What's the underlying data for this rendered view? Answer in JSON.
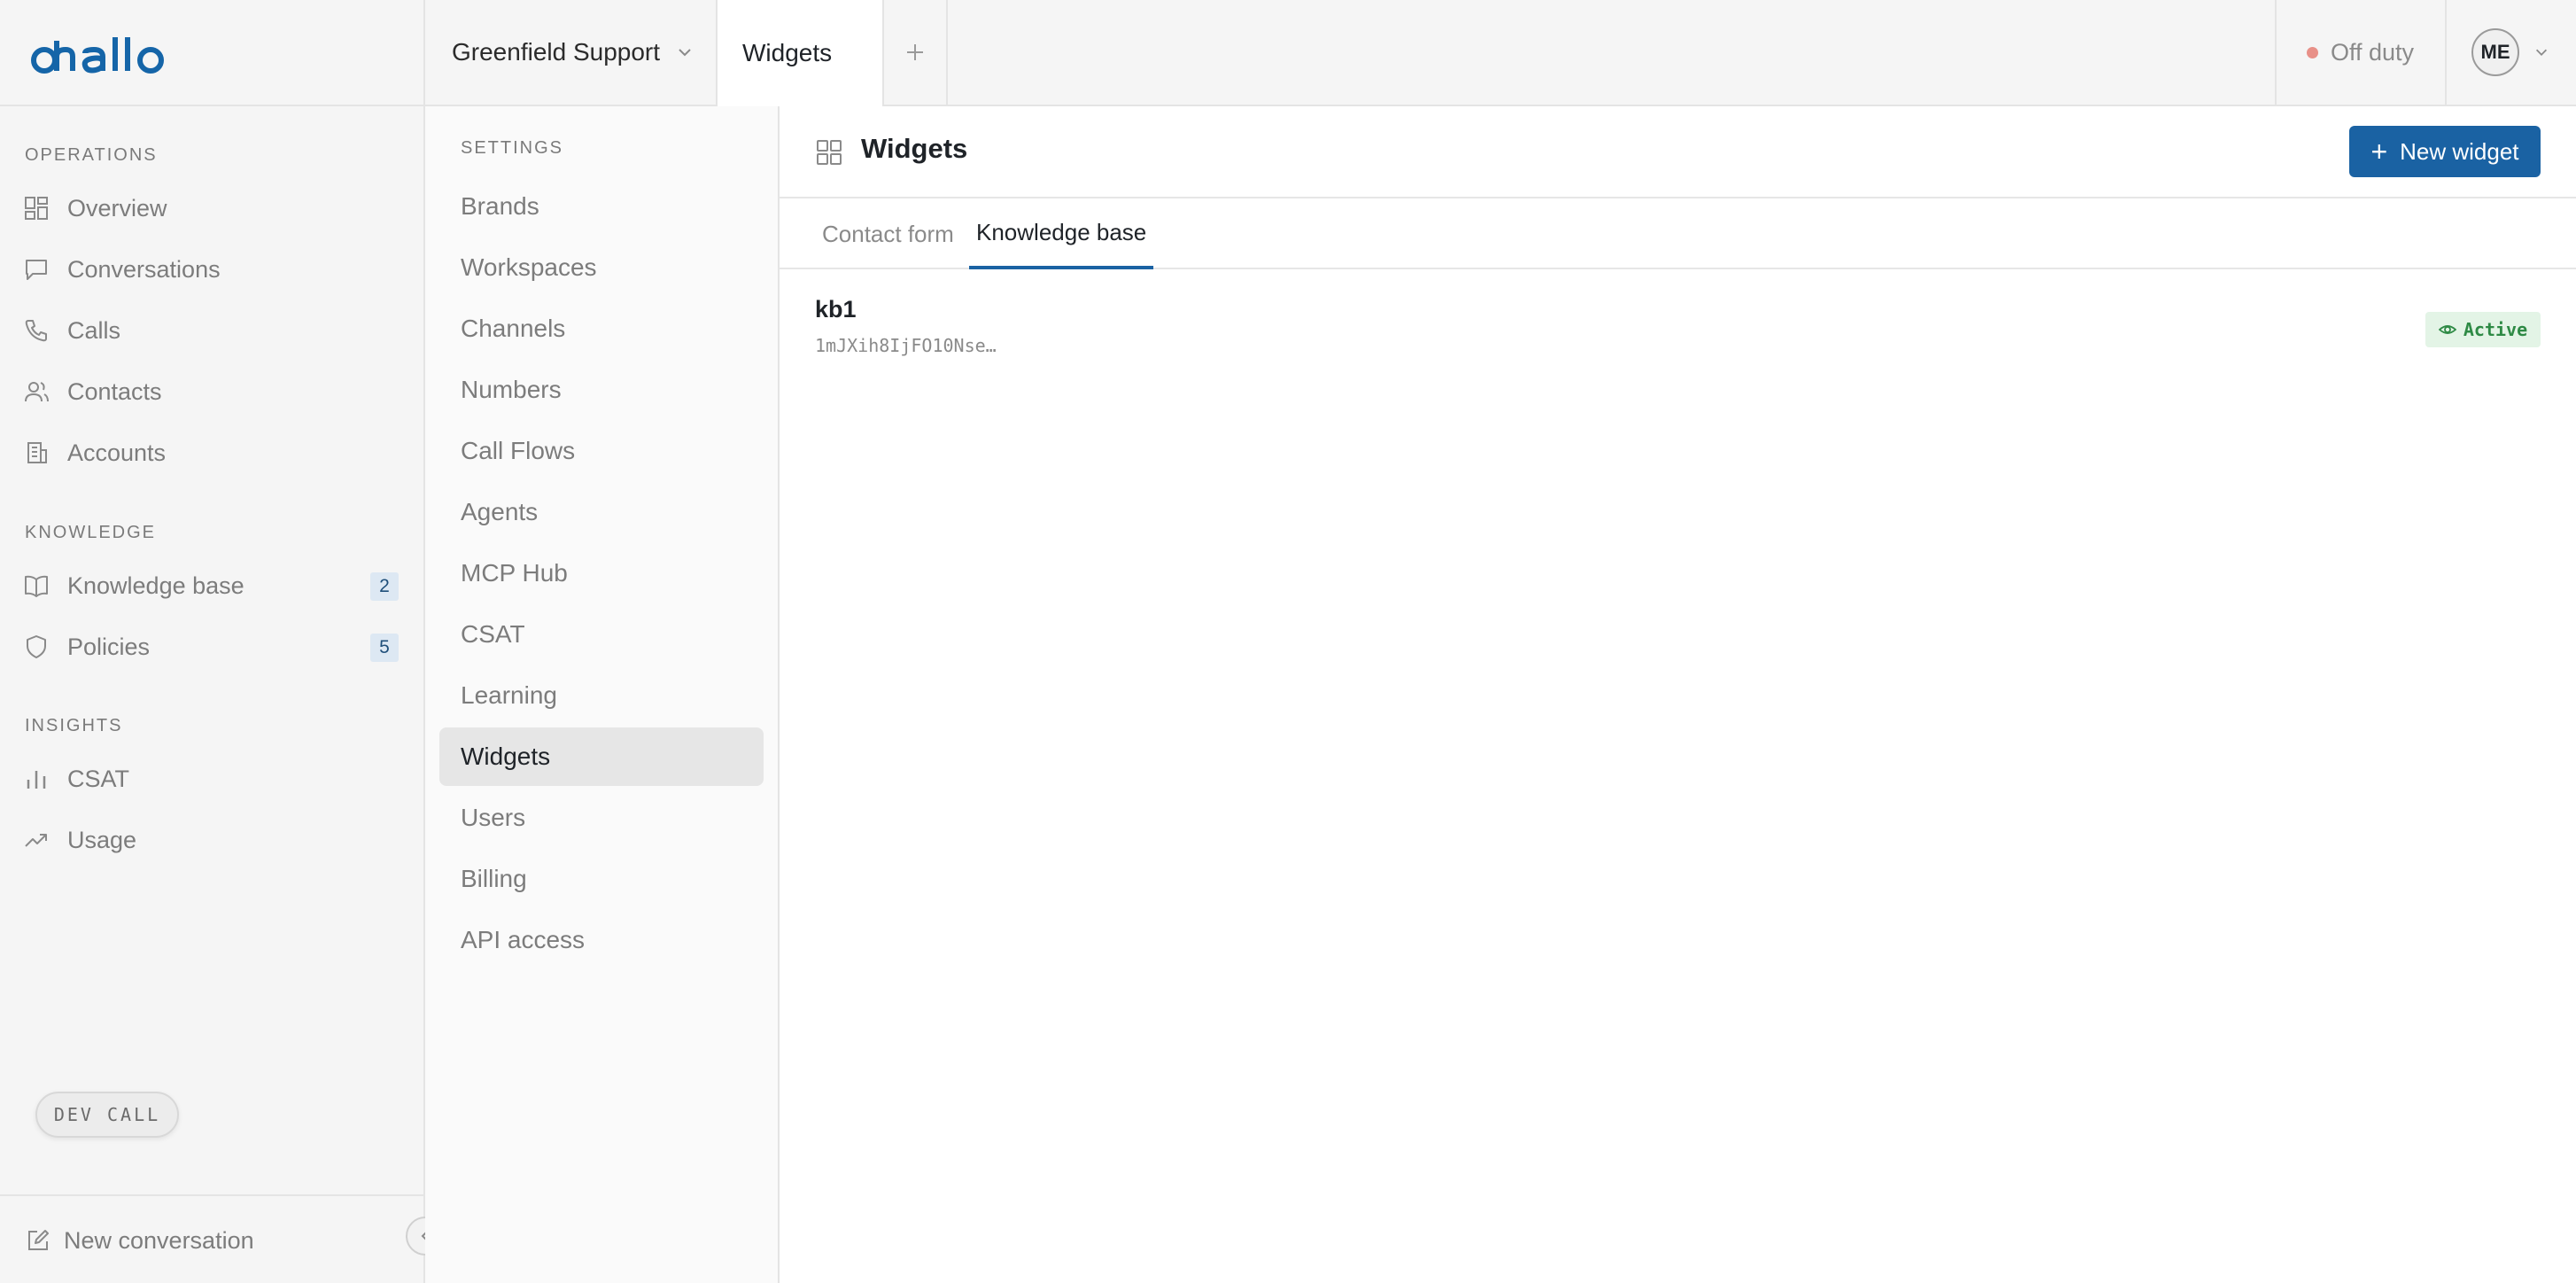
{
  "brand": {
    "logo_text": "ohallo",
    "accent": "#1565a8"
  },
  "topbar": {
    "workspace": "Greenfield Support",
    "open_tab": "Widgets",
    "status": "Off duty",
    "status_color": "#e89088",
    "user_initials": "ME"
  },
  "sidebar": {
    "sections": [
      {
        "title": "OPERATIONS",
        "items": [
          {
            "label": "Overview",
            "icon": "overview-icon"
          },
          {
            "label": "Conversations",
            "icon": "chat-icon"
          },
          {
            "label": "Calls",
            "icon": "phone-icon"
          },
          {
            "label": "Contacts",
            "icon": "contacts-icon"
          },
          {
            "label": "Accounts",
            "icon": "building-icon"
          }
        ]
      },
      {
        "title": "KNOWLEDGE",
        "items": [
          {
            "label": "Knowledge base",
            "icon": "book-icon",
            "count": "2"
          },
          {
            "label": "Policies",
            "icon": "shield-icon",
            "count": "5"
          }
        ]
      },
      {
        "title": "INSIGHTS",
        "items": [
          {
            "label": "CSAT",
            "icon": "bar-chart-icon"
          },
          {
            "label": "Usage",
            "icon": "trend-icon"
          }
        ]
      }
    ],
    "bottom_action": "New conversation",
    "dev_badge": "DEV CALL"
  },
  "settings": {
    "title": "SETTINGS",
    "items": [
      "Brands",
      "Workspaces",
      "Channels",
      "Numbers",
      "Call Flows",
      "Agents",
      "MCP Hub",
      "CSAT",
      "Learning",
      "Widgets",
      "Users",
      "Billing",
      "API access"
    ],
    "active": "Widgets"
  },
  "main": {
    "title": "Widgets",
    "new_button": "New widget",
    "tabs": [
      "Contact form",
      "Knowledge base"
    ],
    "active_tab": "Knowledge base",
    "rows": [
      {
        "name": "kb1",
        "id": "1mJXih8IjFO10Nse…",
        "status": "Active"
      }
    ]
  }
}
